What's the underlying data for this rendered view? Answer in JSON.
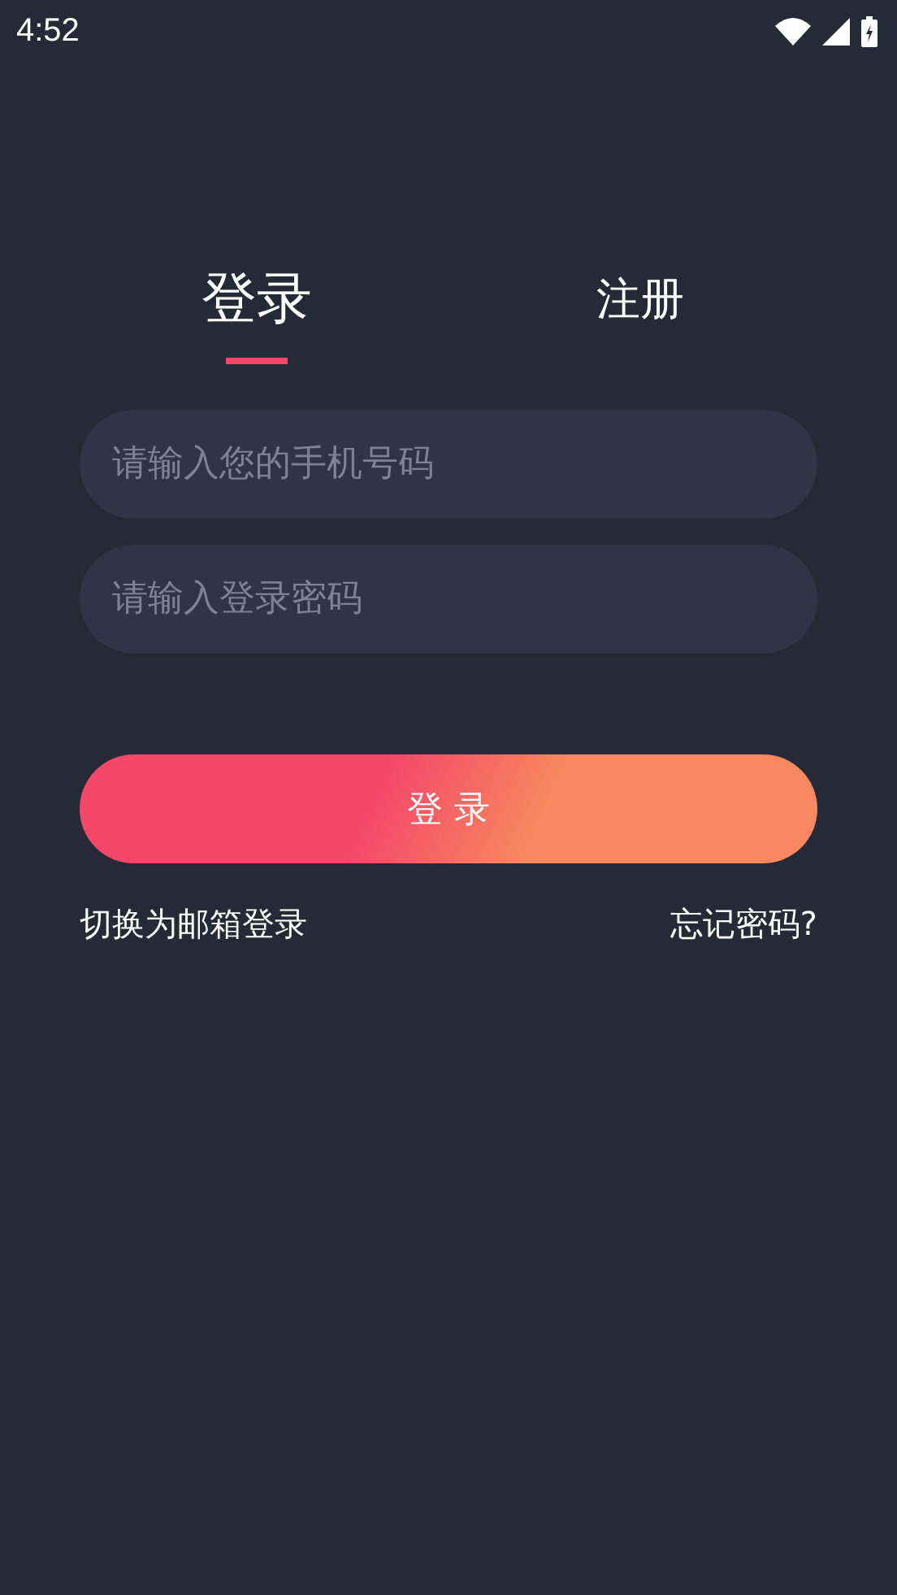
{
  "status_bar": {
    "time": "4:52"
  },
  "tabs": [
    {
      "label": "登录",
      "selected": true
    },
    {
      "label": "注册",
      "selected": false
    }
  ],
  "fields": [
    {
      "placeholder": "请输入您的手机号码"
    },
    {
      "placeholder": "请输入登录密码"
    }
  ],
  "submit_button": "登 录",
  "links": {
    "switch": "切换为邮箱登录",
    "forgot": "忘记密码?"
  }
}
